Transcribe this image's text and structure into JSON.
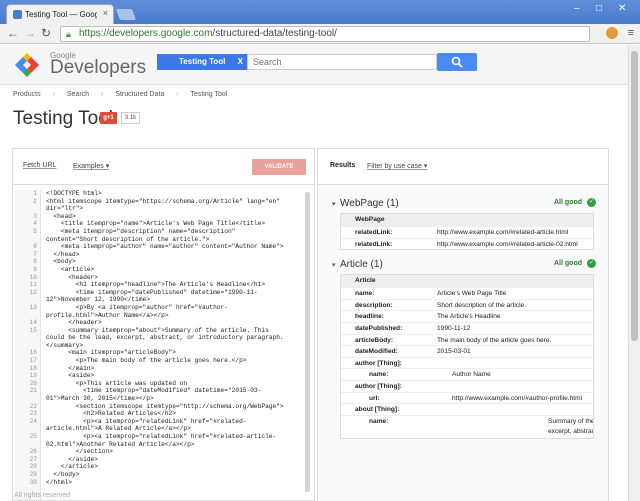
{
  "browser": {
    "tab_title": "Testing Tool — Google Devel...",
    "tab_close": "×",
    "url_host": "https://developers.google.com",
    "url_path": "/structured-data/testing-tool/"
  },
  "header": {
    "logo_google": "Google",
    "logo_developers": "Developers",
    "search_scope": "Testing Tool",
    "search_scope_clear": "X",
    "search_placeholder": "Search"
  },
  "breadcrumb": [
    "Products",
    "Search",
    "Structured Data",
    "Testing Tool"
  ],
  "page": {
    "title": "Testing Tool",
    "gplus_label": "g+1",
    "gplus_count": "3.1k"
  },
  "left_panel": {
    "fetch_url": "Fetch URL",
    "examples": "Examples",
    "validate": "VALIDATE",
    "code_lines": [
      {
        "n": "1",
        "t": "<!DOCTYPE html>"
      },
      {
        "n": "2",
        "t": "<html itemscope itemtype=\"https://schema.org/Article\" lang=\"en\""
      },
      {
        "n": "",
        "t": "dir=\"ltr\">"
      },
      {
        "n": "3",
        "t": "  <head>"
      },
      {
        "n": "4",
        "t": "    <title itemprop=\"name\">Article's Web Page Title</title>"
      },
      {
        "n": "5",
        "t": "    <meta itemprop=\"description\" name=\"description\""
      },
      {
        "n": "",
        "t": "content=\"Short description of the article.\">"
      },
      {
        "n": "6",
        "t": "    <meta itemprop=\"author\" name=\"author\" content=\"Author Name\">"
      },
      {
        "n": "7",
        "t": "  </head>"
      },
      {
        "n": "8",
        "t": "  <body>"
      },
      {
        "n": "9",
        "t": "    <article>"
      },
      {
        "n": "10",
        "t": "      <header>"
      },
      {
        "n": "11",
        "t": "        <h1 itemprop=\"headline\">The Article's Headline</h1>"
      },
      {
        "n": "12",
        "t": "        <time itemprop=\"datePublished\" datetime=\"1990-11-"
      },
      {
        "n": "",
        "t": "12\">November 12, 1990</time>"
      },
      {
        "n": "13",
        "t": "        <p>By <a itemprop=\"author\" href=\"#author-"
      },
      {
        "n": "",
        "t": "profile.html\">Author Name</a></p>"
      },
      {
        "n": "14",
        "t": "      </header>"
      },
      {
        "n": "15",
        "t": "      <summary itemprop=\"about\">Summary of the article. This"
      },
      {
        "n": "",
        "t": "could be the lead, excerpt, abstract, or introductory paragraph."
      },
      {
        "n": "",
        "t": "</summary>"
      },
      {
        "n": "16",
        "t": "      <main itemprop=\"articleBody\">"
      },
      {
        "n": "17",
        "t": "        <p>The main body of the article goes here.</p>"
      },
      {
        "n": "18",
        "t": "      </main>"
      },
      {
        "n": "19",
        "t": "      <aside>"
      },
      {
        "n": "20",
        "t": "        <p>This article was updated on"
      },
      {
        "n": "21",
        "t": "          <time itemprop=\"dateModified\" datetime=\"2015-03-"
      },
      {
        "n": "",
        "t": "01\">March 30, 2015</time></p>"
      },
      {
        "n": "22",
        "t": "        <section itemscope itemtype=\"http://schema.org/WebPage\">"
      },
      {
        "n": "23",
        "t": "          <h2>Related Articles</h2>"
      },
      {
        "n": "24",
        "t": "          <p><a itemprop=\"relatedLink\" href=\"#related-"
      },
      {
        "n": "",
        "t": "article.html\">A Related Article</a></p>"
      },
      {
        "n": "25",
        "t": "          <p><a itemprop=\"relatedLink\" href=\"#related-article-"
      },
      {
        "n": "",
        "t": "02.html\">Another Related Article</a></p>"
      },
      {
        "n": "26",
        "t": "        </section>"
      },
      {
        "n": "27",
        "t": "      </aside>"
      },
      {
        "n": "28",
        "t": "    </article>"
      },
      {
        "n": "29",
        "t": "  </body>"
      },
      {
        "n": "30",
        "t": "</html>"
      }
    ]
  },
  "right_panel": {
    "results": "Results",
    "filter": "Filter by use case",
    "sections": [
      {
        "name": "WebPage (1)",
        "status": "All good",
        "type": "WebPage",
        "rows": [
          {
            "k": "relatedLink:",
            "v": "http://www.example.com/#related-article.html"
          },
          {
            "k": "relatedLink:",
            "v": "http://www.example.com/#related-article-02.html"
          }
        ]
      },
      {
        "name": "Article (1)",
        "status": "All good",
        "type": "Article",
        "rows": [
          {
            "k": "name:",
            "v": "Article's Web Page Title"
          },
          {
            "k": "description:",
            "v": "Short description of the article."
          },
          {
            "k": "headline:",
            "v": "The Article's Headline"
          },
          {
            "k": "datePublished:",
            "v": "1990-11-12"
          },
          {
            "k": "articleBody:",
            "v": "The main body of the article goes here."
          },
          {
            "k": "dateModified:",
            "v": "2015-03-01"
          },
          {
            "k": "author [Thing]:",
            "v": ""
          },
          {
            "k": "name:",
            "v": "Author Name",
            "indent": true
          },
          {
            "k": "author [Thing]:",
            "v": ""
          },
          {
            "k": "url:",
            "v": "http://www.example.com/#author-profile.html",
            "indent": true
          },
          {
            "k": "about [Thing]:",
            "v": ""
          },
          {
            "k": "name:",
            "v": "Summary of the article. This could be the lead, excerpt, abstract, or introductory paragraph.",
            "indent": true,
            "wrap": true
          }
        ]
      }
    ]
  },
  "footer": "All rights reserved",
  "colors": {
    "accent": "#3b78e7",
    "validate": "#e8a29b",
    "good": "#2e7d32"
  }
}
